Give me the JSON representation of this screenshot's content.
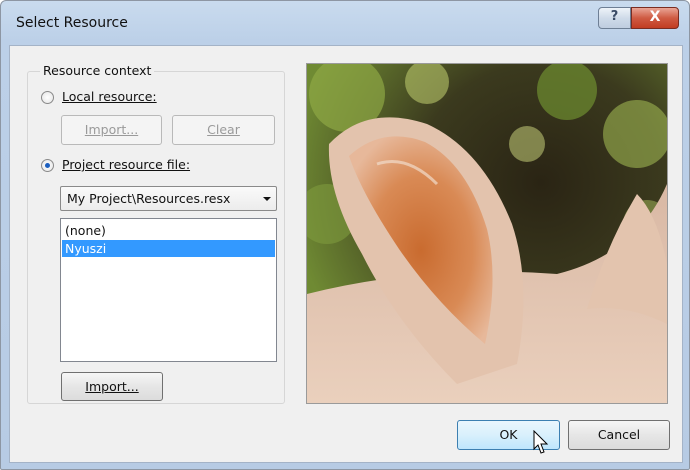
{
  "window": {
    "title": "Select Resource",
    "help_glyph": "?",
    "close_glyph": "X"
  },
  "group": {
    "label": "Resource context"
  },
  "local": {
    "radio_label": "Local resource:",
    "selected": false,
    "import_label": "Import...",
    "clear_label": "Clear"
  },
  "project": {
    "radio_label": "Project resource file:",
    "selected": true,
    "file_combo": {
      "value": "My Project\\Resources.resx"
    },
    "resources": [
      {
        "label": "(none)",
        "selected": false
      },
      {
        "label": "Nyuszi",
        "selected": true
      }
    ],
    "import_label": "Import..."
  },
  "preview": {
    "icon": "rabbit-ear-photo"
  },
  "footer": {
    "ok_label": "OK",
    "cancel_label": "Cancel"
  },
  "colors": {
    "selection": "#3399ff",
    "accent": "#1c5fbf",
    "close_button": "#c23c22"
  }
}
